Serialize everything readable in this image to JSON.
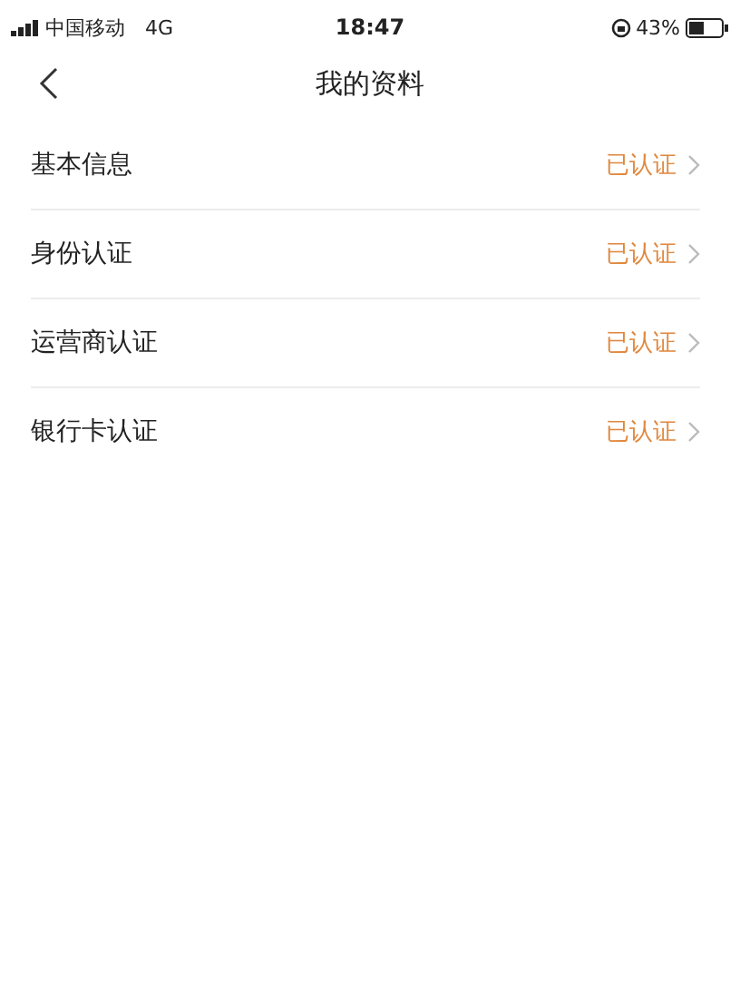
{
  "status_bar": {
    "carrier": "中国移动",
    "network": "4G",
    "time": "18:47",
    "battery": "43%"
  },
  "nav": {
    "title": "我的资料"
  },
  "items": [
    {
      "label": "基本信息",
      "status": "已认证"
    },
    {
      "label": "身份认证",
      "status": "已认证"
    },
    {
      "label": "运营商认证",
      "status": "已认证"
    },
    {
      "label": "银行卡认证",
      "status": "已认证"
    }
  ]
}
